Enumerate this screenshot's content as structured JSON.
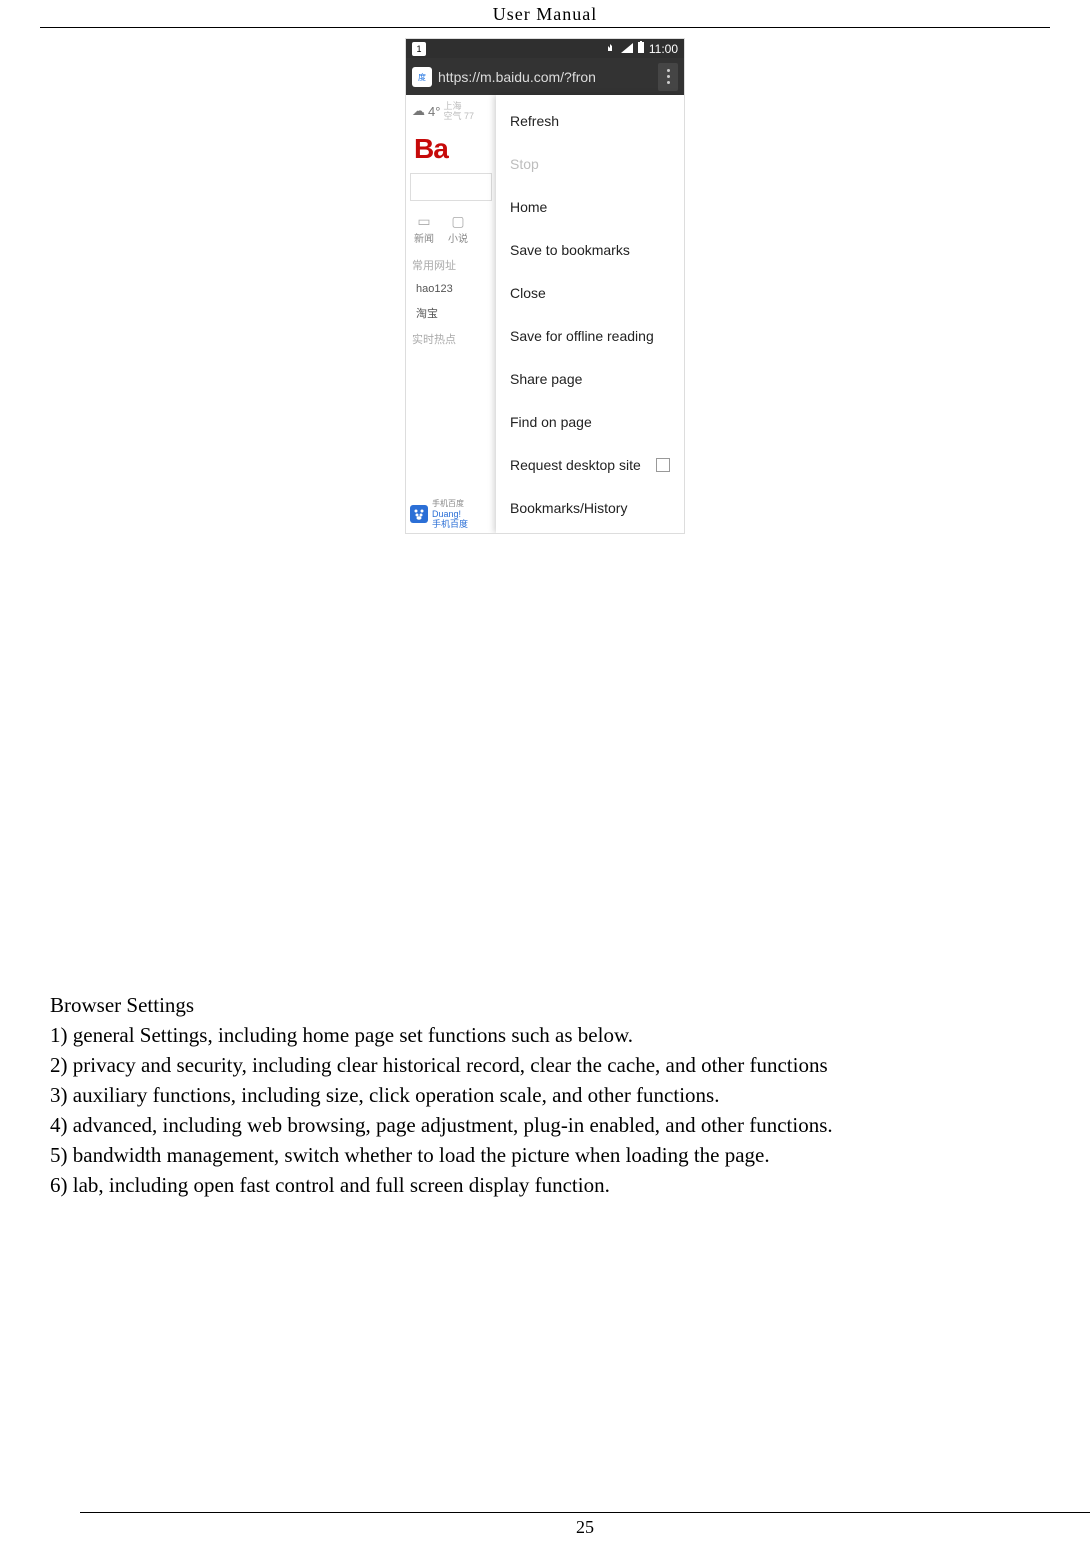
{
  "header": {
    "title": "User  Manual"
  },
  "phone": {
    "status": {
      "notification_badge": "1",
      "time": "11:00"
    },
    "urlbar": {
      "url": "https://m.baidu.com/?fron"
    },
    "left": {
      "weather_icon": "☁",
      "temp": "4°",
      "city": "上海",
      "aqi": "空气 77",
      "logo": "Ba",
      "icon1_glyph": "▭",
      "icon1_label": "新闻",
      "icon2_glyph": "▢",
      "icon2_label": "小说",
      "section1": "常用网址",
      "link1": "hao123",
      "link2": "淘宝",
      "section2": "实时热点",
      "footer_line1": "Duang!",
      "footer_line2": "手机百度",
      "footer_sub": "手机百度"
    },
    "menu": {
      "refresh": "Refresh",
      "stop": "Stop",
      "home": "Home",
      "save_bookmarks": "Save to bookmarks",
      "close": "Close",
      "save_offline": "Save for offline reading",
      "share": "Share page",
      "find": "Find on page",
      "desktop": "Request desktop site",
      "bookmarks_history": "Bookmarks/History"
    }
  },
  "body_text": {
    "heading": "Browser Settings",
    "lines": [
      "1) general Settings, including home page set functions such as below.",
      "2) privacy and security, including clear historical record, clear the cache, and other functions",
      "3) auxiliary functions, including size, click operation scale, and other functions.",
      "4) advanced, including web browsing, page adjustment, plug-in enabled, and other functions.",
      "5) bandwidth management, switch whether to load the picture when loading the page.",
      "6) lab, including open fast control and full screen display function."
    ]
  },
  "page_number": "25"
}
